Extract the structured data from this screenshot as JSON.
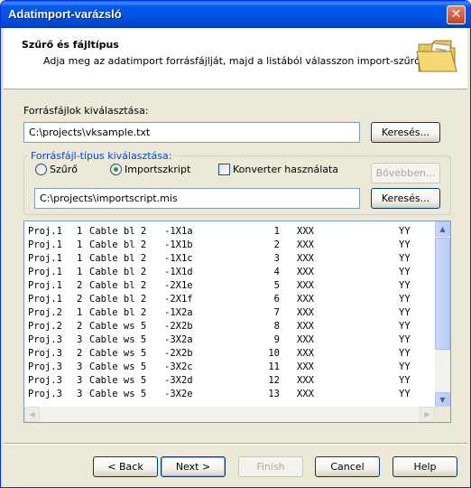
{
  "window": {
    "title": "Adatimport-varázsló"
  },
  "header": {
    "title": "Szűrő és fájltípus",
    "subtitle": "Adja meg az adatimport forrásfájlját, majd a listából válasszon import-szűrőt."
  },
  "source": {
    "label": "Forrásfájlok kiválasztása:",
    "path": "C:\\projects\\vksample.txt",
    "browse_label": "Keresés..."
  },
  "filetype": {
    "legend": "Forrásfájl-típus kiválasztása:",
    "option_filter": "Szűrő",
    "option_script": "Importszkript",
    "converter_label": "Konverter használata",
    "more_label": "Bővebben...",
    "script_path": "C:\\projects\\importscript.mis",
    "browse_label": "Keresés..."
  },
  "preview_rows": [
    [
      "Proj.1",
      "1",
      "Cable bl 2",
      "-1X1a",
      "1",
      "XXX",
      "YY"
    ],
    [
      "Proj.1",
      "1",
      "Cable bl 2",
      "-1X1b",
      "2",
      "XXX",
      "YY"
    ],
    [
      "Proj.1",
      "1",
      "Cable bl 2",
      "-1X1c",
      "3",
      "XXX",
      "YY"
    ],
    [
      "Proj.1",
      "1",
      "Cable bl 2",
      "-1X1d",
      "4",
      "XXX",
      "YY"
    ],
    [
      "Proj.1",
      "2",
      "Cable bl 2",
      "-2X1e",
      "5",
      "XXX",
      "YY"
    ],
    [
      "Proj.1",
      "2",
      "Cable bl 2",
      "-2X1f",
      "6",
      "XXX",
      "YY"
    ],
    [
      "Proj.2",
      "1",
      "Cable bl 2",
      "-1X2a",
      "7",
      "XXX",
      "YY"
    ],
    [
      "Proj.2",
      "2",
      "Cable ws 5",
      "-2X2b",
      "8",
      "XXX",
      "YY"
    ],
    [
      "Proj.3",
      "3",
      "Cable ws 5",
      "-3X2a",
      "9",
      "XXX",
      "YY"
    ],
    [
      "Proj.3",
      "2",
      "Cable ws 5",
      "-2X2b",
      "10",
      "XXX",
      "YY"
    ],
    [
      "Proj.3",
      "3",
      "Cable ws 5",
      "-3X2c",
      "11",
      "XXX",
      "YY"
    ],
    [
      "Proj.3",
      "3",
      "Cable ws 5",
      "-3X2d",
      "12",
      "XXX",
      "YY"
    ],
    [
      "Proj.3",
      "3",
      "Cable ws 5",
      "-3X2e",
      "13",
      "XXX",
      "YY"
    ]
  ],
  "buttons": {
    "back": "< Back",
    "next": "Next >",
    "finish": "Finish",
    "cancel": "Cancel",
    "help": "Help"
  },
  "icons": {
    "close": "close-icon",
    "folder": "folder-icon"
  }
}
